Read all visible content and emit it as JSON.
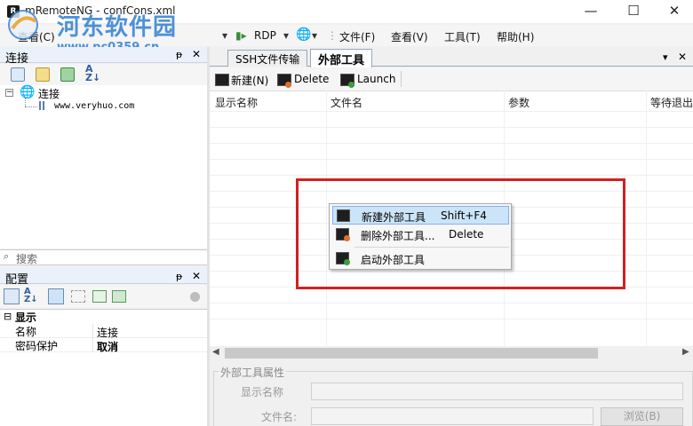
{
  "window": {
    "title": "mRemoteNG - confCons.xml",
    "minimize": "—",
    "maximize": "☐",
    "close": "✕"
  },
  "watermark": {
    "title": "河东软件园",
    "url": "www.pc0359.cn"
  },
  "toolbar": {
    "view_label": "查看(C)",
    "rdp_label": "RDP",
    "menus": [
      "文件(F)",
      "查看(V)",
      "工具(T)",
      "帮助(H)"
    ]
  },
  "connections_panel": {
    "title": "连接",
    "pin": "ᵽ",
    "close": "✕",
    "tree": {
      "root": "连接",
      "child": "www.veryhuo.com"
    },
    "search_placeholder": "搜索"
  },
  "config_panel": {
    "title": "配置",
    "pin": "ᵽ",
    "close": "✕",
    "category": "显示",
    "rows": [
      {
        "name": "名称",
        "value": "连接"
      },
      {
        "name": "密码保护",
        "value": "取消"
      }
    ]
  },
  "tabs": [
    {
      "label": "SSH文件传输",
      "active": false
    },
    {
      "label": "外部工具",
      "active": true
    }
  ],
  "ext_toolbar": {
    "new": "新建(N)",
    "delete": "Delete",
    "launch": "Launch"
  },
  "grid": {
    "columns": [
      "显示名称",
      "文件名",
      "参数",
      "等待退出"
    ]
  },
  "context_menu": {
    "items": [
      {
        "label": "新建外部工具",
        "shortcut": "Shift+F4",
        "icon": "new-tool-icon"
      },
      {
        "label": "删除外部工具...",
        "shortcut": "Delete",
        "icon": "delete-tool-icon"
      },
      {
        "label": "启动外部工具",
        "shortcut": "",
        "icon": "launch-tool-icon"
      }
    ]
  },
  "properties": {
    "group_title": "外部工具属性",
    "display_name_label": "显示名称",
    "filename_label": "文件名:",
    "browse_button": "浏览(B)"
  },
  "colors": {
    "highlight": "#d21f1f",
    "menu_active": "#cce4f7"
  }
}
